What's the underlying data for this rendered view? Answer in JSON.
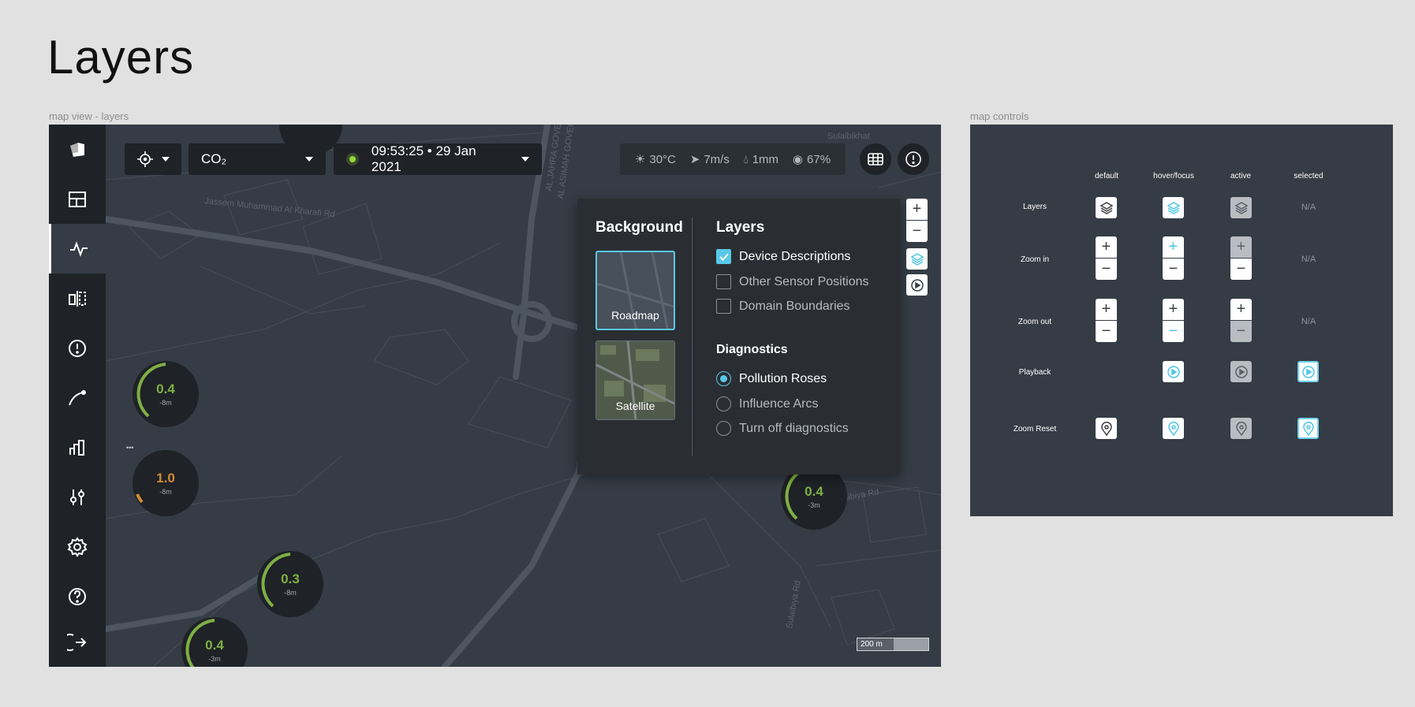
{
  "page": {
    "title": "Layers"
  },
  "frames": {
    "map_label": "map view - layers",
    "controls_label": "map controls"
  },
  "sidebar": {
    "items": [
      {
        "icon": "logo-icon"
      },
      {
        "icon": "dashboard-icon"
      },
      {
        "icon": "activity-icon",
        "active": true
      },
      {
        "icon": "compare-icon"
      },
      {
        "icon": "alert-icon"
      },
      {
        "icon": "curve-icon"
      },
      {
        "icon": "bar-chart-icon"
      },
      {
        "icon": "sliders-icon"
      },
      {
        "icon": "settings-icon"
      },
      {
        "icon": "help-icon"
      },
      {
        "icon": "logout-icon"
      }
    ]
  },
  "toolbar": {
    "pollutant": "CO₂",
    "datetime": "09:53:25 • 29 Jan 2021",
    "weather": {
      "temp": "30°C",
      "wind": "7m/s",
      "rain": "1mm",
      "humidity": "67%"
    }
  },
  "map": {
    "labels": [
      "Sulaibikhat",
      "AL JAHRA GOVERNORATE",
      "AL ASIMAH GOVERNORATE",
      "Jassem Muhammad Al Kharafi Rd",
      "Sulaibiya Rd",
      "Sulaibiya Rd"
    ],
    "scale": "200 m",
    "sensors": [
      {
        "value": "0.4",
        "sub": "-8m",
        "color": "#7fb043"
      },
      {
        "value": "1.0",
        "sub": "-8m",
        "color": "#d38b35"
      },
      {
        "value": "0.3",
        "sub": "-8m",
        "color": "#7fb043"
      },
      {
        "value": "0.4",
        "sub": "-3m",
        "color": "#7fb043"
      },
      {
        "value": "0.4",
        "sub": "-3m",
        "color": "#7fb043"
      }
    ],
    "cluster_label": "•••"
  },
  "layers_panel": {
    "background_title": "Background",
    "backgrounds": [
      {
        "label": "Roadmap",
        "selected": true
      },
      {
        "label": "Satellite",
        "selected": false
      }
    ],
    "layers_title": "Layers",
    "layers": [
      {
        "label": "Device Descriptions",
        "checked": true
      },
      {
        "label": "Other Sensor Positions",
        "checked": false
      },
      {
        "label": "Domain Boundaries",
        "checked": false
      }
    ],
    "diagnostics_title": "Diagnostics",
    "diagnostics": [
      {
        "label": "Pollution Roses",
        "selected": true
      },
      {
        "label": "Influence Arcs",
        "selected": false
      },
      {
        "label": "Turn off diagnostics",
        "selected": false
      }
    ]
  },
  "map_controls": {
    "columns": [
      "default",
      "hover/focus",
      "active",
      "selected"
    ],
    "rows": [
      "Layers",
      "Zoom in",
      "Zoom out",
      "Playback",
      "Zoom Reset"
    ],
    "na": "N/A"
  },
  "colors": {
    "accent": "#5ac8e8",
    "sidebar": "#1f2226",
    "map": "#353c45",
    "sensor_green": "#7fb043",
    "sensor_orange": "#d38b35"
  }
}
